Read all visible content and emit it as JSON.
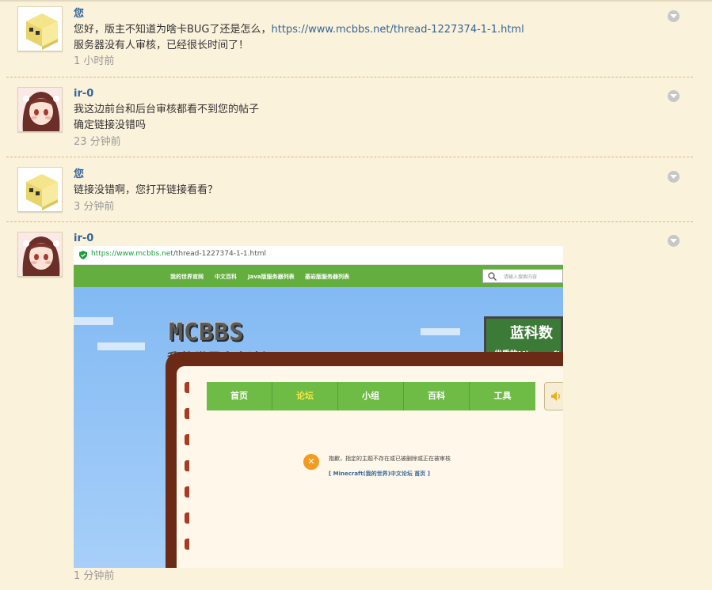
{
  "messages": [
    {
      "sender": "您",
      "lines": [
        "您好，版主不知道为啥卡BUG了还是怎么，",
        "服务器没有人审核，已经很长时间了！"
      ],
      "link": "https://www.mcbbs.net/thread-1227374-1-1.html",
      "time": "1 小时前"
    },
    {
      "sender": "ir-0",
      "lines": [
        "我这边前台和后台审核都看不到您的帖子",
        "确定链接没错吗"
      ],
      "time": "23 分钟前"
    },
    {
      "sender": "您",
      "lines": [
        "链接没错啊，您打开链接看看？"
      ],
      "time": "3 分钟前"
    },
    {
      "sender": "ir-0",
      "time": "1 分钟前",
      "screenshot": {
        "url_host": "https://www.mcbbs.net",
        "url_path": "/thread-1227374-1-1.html",
        "nav_links": [
          "我的世界官网",
          "中文百科",
          "Java版服务器列表",
          "基岩版服务器列表"
        ],
        "search_placeholder": "请输入搜索内容",
        "logo_text": "MCBBS",
        "logo_sub": "我的世界中文论坛",
        "ad_title": "蓝科数",
        "ad_sub": "·优质的Minecraft",
        "tabs": [
          "首页",
          "论坛",
          "小组",
          "百科",
          "工具"
        ],
        "active_tab": "论坛",
        "error_text": "抱歉，指定的主题不存在或已被删除或正在被审核",
        "error_link": "[ Minecraft(我的世界)中文论坛 首页 ]"
      }
    }
  ],
  "icons": {
    "menu": "chevron-down-icon",
    "avatar_user": "avatar-block-icon",
    "avatar_other": "avatar-anime-girl"
  },
  "colors": {
    "background": "#fbf2db",
    "name": "#336699",
    "separator": "#d9b87f",
    "time": "#999999"
  }
}
